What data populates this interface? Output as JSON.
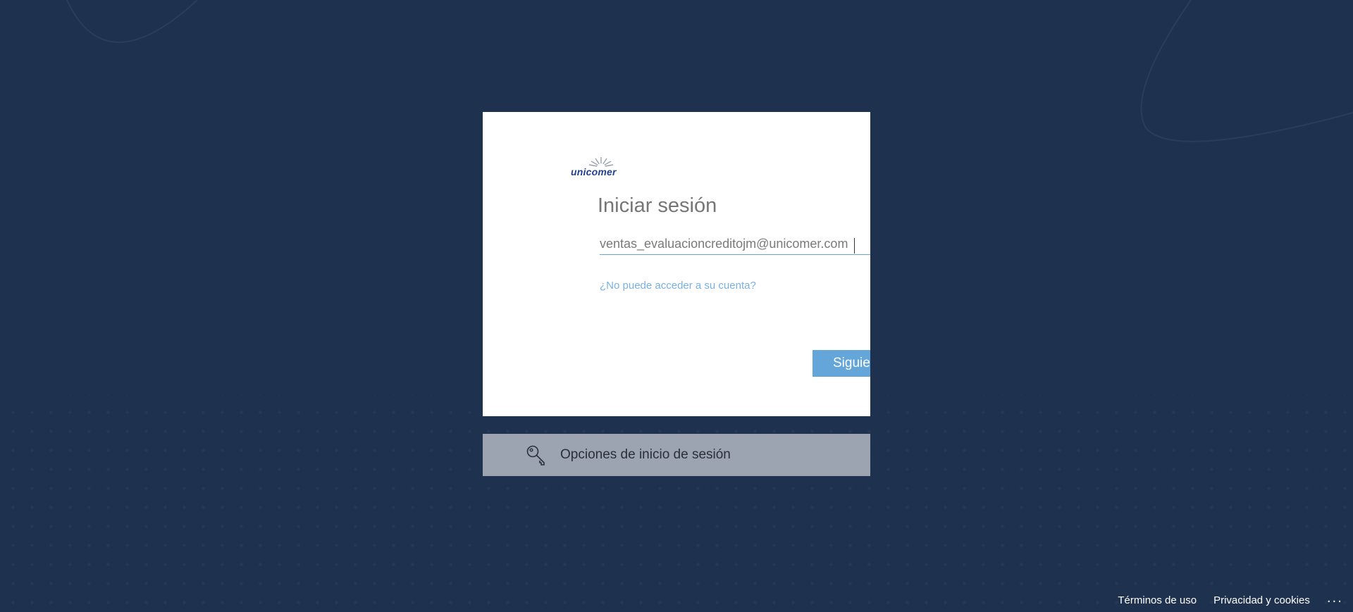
{
  "background": {
    "color": "#1e314f"
  },
  "card": {
    "logo_text": "unicomer",
    "title": "Iniciar sesión",
    "email_value": "ventas_evaluacioncreditojm@unicomer.com",
    "help_link": "¿No puede acceder a su cuenta?",
    "next_label": "Siguiente",
    "accent_color": "#64a5da"
  },
  "signin_options": {
    "label": "Opciones de inicio de sesión",
    "icon": "key-icon"
  },
  "footer": {
    "terms": "Términos de uso",
    "privacy": "Privacidad y cookies",
    "more": "..."
  }
}
